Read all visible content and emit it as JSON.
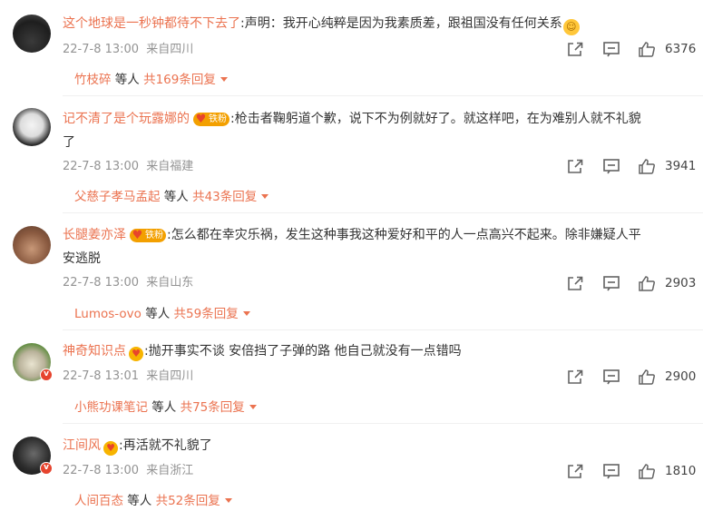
{
  "comments": [
    {
      "username": "这个地球是一秒钟都待不下去了",
      "fan_badge": "",
      "text": ":声明：我开心纯粹是因为我素质差，跟祖国没有任何关系",
      "text_line2": "",
      "timestamp": "22-7-8 13:00",
      "location": "来自四川",
      "likes": "6376",
      "reply_name": "竹枝碎",
      "reply_mid": " 等人 ",
      "reply_count": "共169条回复",
      "avatar_icon": "avatar-dark-group"
    },
    {
      "username": "记不清了是个玩露娜的",
      "fan_badge": "铁粉",
      "text": ":枪击者鞠躬道个歉，说下不为例就好了。就这样吧，在为难别人就不礼貌",
      "text_line2": "了",
      "timestamp": "22-7-8 13:00",
      "location": "来自福建",
      "likes": "3941",
      "reply_name": "父慈子孝马孟起",
      "reply_mid": " 等人 ",
      "reply_count": "共43条回复",
      "avatar_icon": "avatar-anime-face"
    },
    {
      "username": "长腿姜亦泽",
      "fan_badge": "铁粉",
      "text": ":怎么都在幸灾乐祸，发生这种事我这种爱好和平的人一点高兴不起来。除非嫌疑人平",
      "text_line2": "安逃脱",
      "timestamp": "22-7-8 13:00",
      "location": "来自山东",
      "likes": "2903",
      "reply_name": "Lumos-ovo",
      "reply_mid": " 等人 ",
      "reply_count": "共59条回复",
      "avatar_icon": "avatar-torso"
    },
    {
      "username": "神奇知识点",
      "fan_badge": "",
      "text": ":抛开事实不谈 安倍挡了子弹的路 他自己就没有一点错吗",
      "text_line2": "",
      "timestamp": "22-7-8 13:01",
      "location": "来自四川",
      "likes": "2900",
      "reply_name": "小熊功课笔记",
      "reply_mid": " 等人 ",
      "reply_count": "共75条回复",
      "avatar_icon": "avatar-cat"
    },
    {
      "username": "江间风",
      "fan_badge": "",
      "text": ":再活就不礼貌了",
      "text_line2": "",
      "timestamp": "22-7-8 13:00",
      "location": "来自浙江",
      "likes": "1810",
      "reply_name": "人间百态",
      "reply_mid": " 等人 ",
      "reply_count": "共52条回复",
      "avatar_icon": "avatar-person"
    }
  ],
  "icons": {
    "share": "share-icon",
    "comment": "comment-icon",
    "like": "thumbs-up-icon",
    "expand": "caret-down-icon"
  },
  "colors": {
    "username": "#eb7350",
    "meta": "#939393",
    "badge": "#f3a000"
  }
}
